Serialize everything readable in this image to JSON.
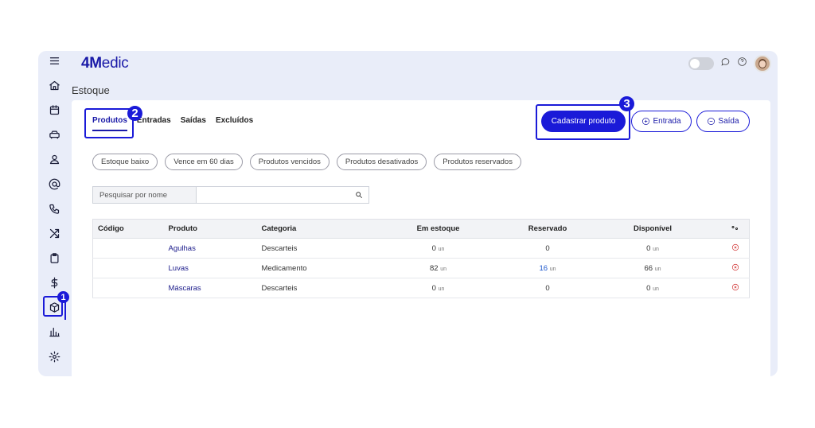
{
  "app": {
    "logo_bold": "4M",
    "logo_rest": "edic",
    "page_title": "Estoque"
  },
  "sidebar": {
    "items": [
      "menu-icon",
      "home-icon",
      "calendar-icon",
      "car-icon",
      "user-icon",
      "at-icon",
      "phone-icon",
      "shuffle-icon",
      "clipboard-icon",
      "dollar-icon",
      "box-icon",
      "chart-icon",
      "settings-icon"
    ]
  },
  "annotations": {
    "one": "1",
    "two": "2",
    "three": "3"
  },
  "tabs": [
    "Produtos",
    "Entradas",
    "Saídas",
    "Excluídos"
  ],
  "actions": {
    "create": "Cadastrar produto",
    "entrada": "Entrada",
    "saida": "Saída"
  },
  "filters": [
    "Estoque baixo",
    "Vence em 60 dias",
    "Produtos vencidos",
    "Produtos desativados",
    "Produtos reservados"
  ],
  "search": {
    "label": "Pesquisar por nome",
    "value": ""
  },
  "table": {
    "headers": [
      "Código",
      "Produto",
      "Categoria",
      "Em estoque",
      "Reservado",
      "Disponível"
    ],
    "unit": "un",
    "rows": [
      {
        "code": "",
        "product": "Agulhas",
        "category": "Descarteis",
        "stock": "0",
        "reserved": "0",
        "available": "0"
      },
      {
        "code": "",
        "product": "Luvas",
        "category": "Medicamento",
        "stock": "82",
        "reserved": "16",
        "available": "66"
      },
      {
        "code": "",
        "product": "Máscaras",
        "category": "Descarteis",
        "stock": "0",
        "reserved": "0",
        "available": "0"
      }
    ]
  },
  "colors": {
    "accent": "#1a1ad8",
    "background": "#e9edf9",
    "delete": "#d03030"
  }
}
